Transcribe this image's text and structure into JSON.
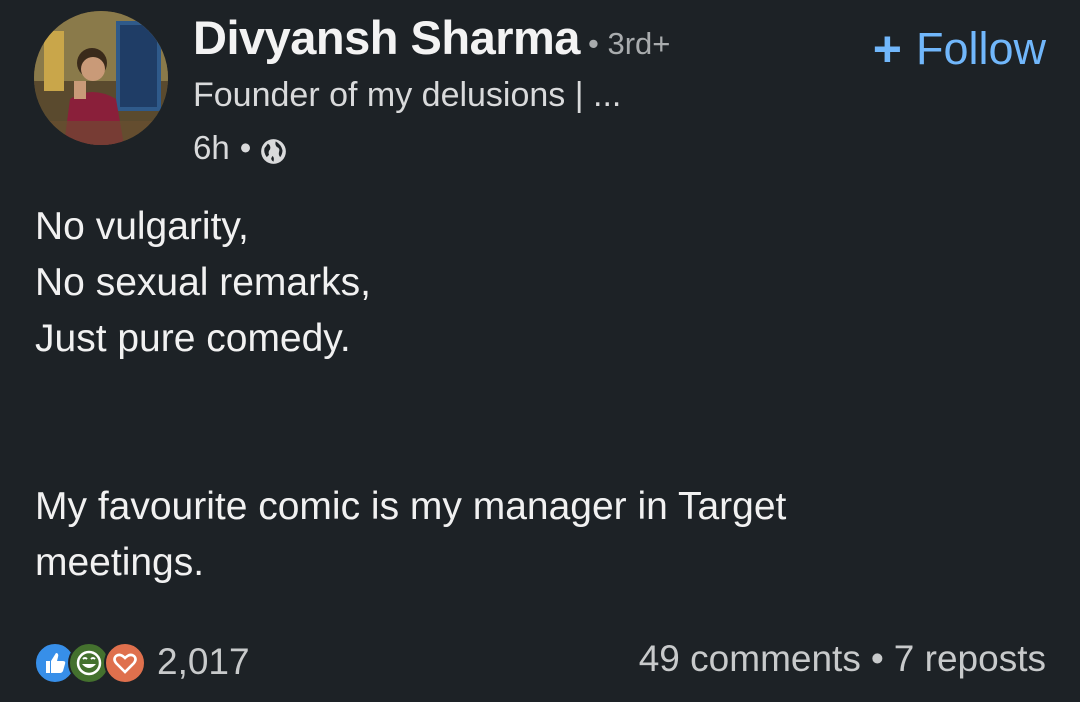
{
  "author": {
    "name": "Divyansh Sharma",
    "degree": "• 3rd+",
    "headline": "Founder of my delusions | ...",
    "posted_ago": "6h",
    "visibility_icon": "globe-icon"
  },
  "follow": {
    "plus": "+",
    "label": "Follow"
  },
  "post": {
    "lines": [
      "No vulgarity,",
      "No sexual remarks,",
      "Just pure comedy.",
      "My favourite comic is my manager in Target",
      "meetings."
    ]
  },
  "reactions": {
    "icons": [
      "like-icon",
      "funny-icon",
      "love-icon"
    ],
    "count": "2,017"
  },
  "social": {
    "comments": "49 comments",
    "reposts": "7 reposts"
  },
  "colors": {
    "background": "#1d2226",
    "accent": "#71b7fb",
    "like": "#378fe9",
    "funny": "#44712e",
    "love": "#df704d"
  }
}
